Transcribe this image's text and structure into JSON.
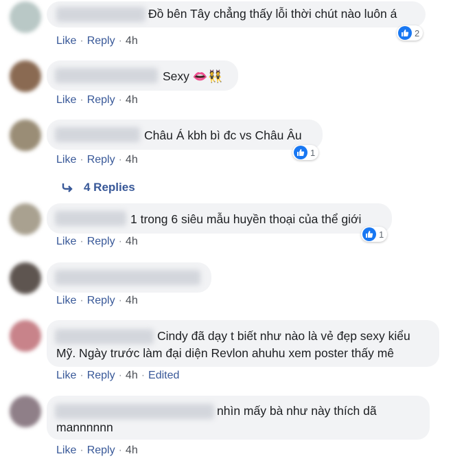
{
  "actions": {
    "like": "Like",
    "reply": "Reply",
    "edited": "Edited"
  },
  "comments": [
    {
      "text": "Đồ bên Tây chẳng thấy lỗi thời chút nào luôn á",
      "time": "4h",
      "reactions": "2",
      "avatar_color": "#b9c8c6"
    },
    {
      "text": "Sexy 👄👯",
      "time": "4h",
      "avatar_color": "#8a6a52"
    },
    {
      "text": "Châu Á kbh bì đc vs Châu Âu",
      "time": "4h",
      "reactions": "1",
      "avatar_color": "#9a8d76"
    },
    {
      "text": "1 trong 6 siêu mẫu huyền thoại của thể giới",
      "time": "4h",
      "reactions": "1",
      "avatar_color": "#a9a190"
    },
    {
      "text": "",
      "time": "4h",
      "avatar_color": "#5e5550"
    },
    {
      "line1": "Cindy đã dạy t biết như nào là vẻ đẹp sexy kiểu",
      "line2": "Mỹ. Ngày trước làm đại diện Revlon ahuhu xem poster thấy mê",
      "time": "4h",
      "avatar_color": "#c8838a"
    },
    {
      "line1": "nhìn mấy bà như này thích dã",
      "line2": "mannnnnn",
      "time": "4h",
      "avatar_color": "#8f7f88"
    }
  ],
  "replies_label": "4 Replies"
}
